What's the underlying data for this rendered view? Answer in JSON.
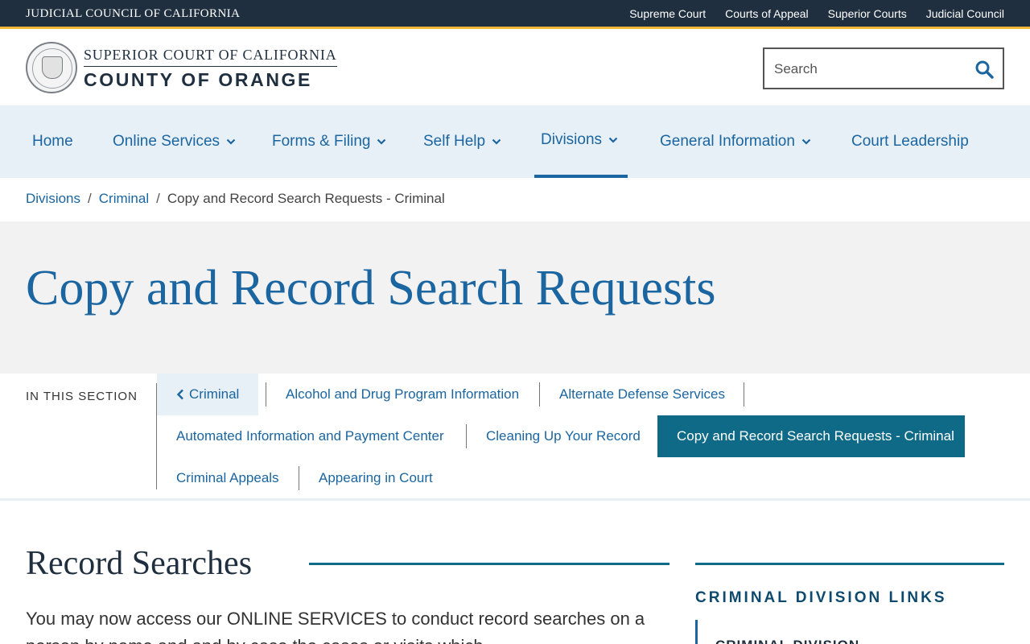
{
  "topbar": {
    "brand": "JUDICIAL COUNCIL OF CALIFORNIA",
    "links": [
      "Supreme Court",
      "Courts of Appeal",
      "Superior Courts",
      "Judicial Council"
    ]
  },
  "header": {
    "court_line1": "SUPERIOR COURT OF CALIFORNIA",
    "court_line2": "COUNTY OF ORANGE",
    "search_placeholder": "Search"
  },
  "nav": {
    "items": [
      {
        "label": "Home",
        "dropdown": false
      },
      {
        "label": "Online Services",
        "dropdown": true
      },
      {
        "label": "Forms & Filing",
        "dropdown": true
      },
      {
        "label": "Self Help",
        "dropdown": true
      },
      {
        "label": "Divisions",
        "dropdown": true,
        "active": true
      },
      {
        "label": "General Information",
        "dropdown": true
      },
      {
        "label": "Court Leadership",
        "dropdown": false
      }
    ]
  },
  "breadcrumb": {
    "items": [
      "Divisions",
      "Criminal"
    ],
    "current": "Copy and Record Search Requests - Criminal"
  },
  "hero": {
    "title": "Copy and Record Search Requests"
  },
  "section_nav": {
    "label": "IN THIS SECTION",
    "back": "Criminal",
    "links": [
      "Alcohol and Drug Program Information",
      "Alternate Defense Services",
      "Automated Information and Payment Center",
      "Cleaning Up Your Record",
      "Copy and Record Search Requests - Criminal",
      "Criminal Appeals",
      "Appearing in Court"
    ]
  },
  "content": {
    "heading": "Record Searches",
    "paragraph": "You may now access our ONLINE SERVICES to conduct record searches on a",
    "paragraph_cont": "person by name and and by case the cases or visits which"
  },
  "sidebar": {
    "title": "CRIMINAL DIVISION LINKS",
    "first_link": "CRIMINAL DIVISION"
  },
  "colors": {
    "brand_dark": "#1f2f3f",
    "accent_gold": "#f2b83a",
    "link_blue": "#1b65a0",
    "teal": "#0e6a87",
    "nav_bg": "#e7f0f7",
    "hero_bg": "#f2f2f2"
  }
}
